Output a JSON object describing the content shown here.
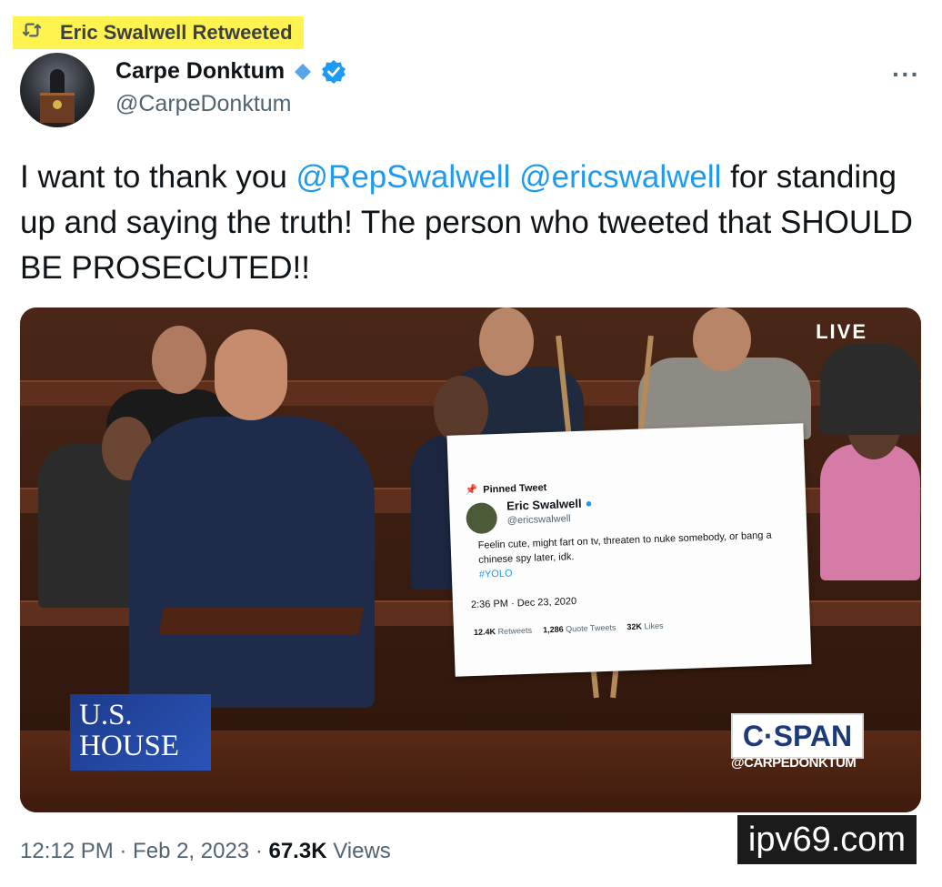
{
  "retweet_banner": {
    "icon": "retweet-icon",
    "label": "Eric Swalwell Retweeted"
  },
  "author": {
    "name": "Carpe Donktum",
    "handle": "@CarpeDonktum",
    "verified_color": "#1d9bf0",
    "diamond_color": "#1d9bf0"
  },
  "menu": {
    "icon": "more-icon",
    "label": "···"
  },
  "tweet": {
    "text_before": "I want to thank you ",
    "mention1": "@RepSwalwell",
    "space": " ",
    "mention2": "@ericswalwell",
    "text_after": " for standing up and saying the truth! The person who tweeted that SHOULD BE PROSECUTED!!"
  },
  "media": {
    "live_label": "LIVE",
    "house_line1": "U.S.",
    "house_line2": "HOUSE",
    "cspan_logo": "C·SPAN",
    "cspan_handle": "@CARPEDONKTUM",
    "poster": {
      "pinned_label": "Pinned Tweet",
      "name": "Eric Swalwell",
      "handle": "@ericswalwell",
      "text": "Feelin cute, might fart on tv, threaten to nuke somebody, or bang a chinese spy later, idk.",
      "hashtag": "#YOLO",
      "timestamp": "2:36 PM · Dec 23, 2020",
      "retweets_count": "12.4K",
      "retweets_label": "Retweets",
      "quotes_count": "1,286",
      "quotes_label": "Quote Tweets",
      "likes_count": "32K",
      "likes_label": "Likes"
    }
  },
  "footer": {
    "time": "12:12 PM · Feb 2, 2023 · ",
    "views_count": "67.3K",
    "views_label": " Views"
  },
  "watermark": "ipv69.com",
  "colors": {
    "accent": "#1d9bf0",
    "highlight": "#fff44f",
    "secondary_text": "#536471"
  }
}
